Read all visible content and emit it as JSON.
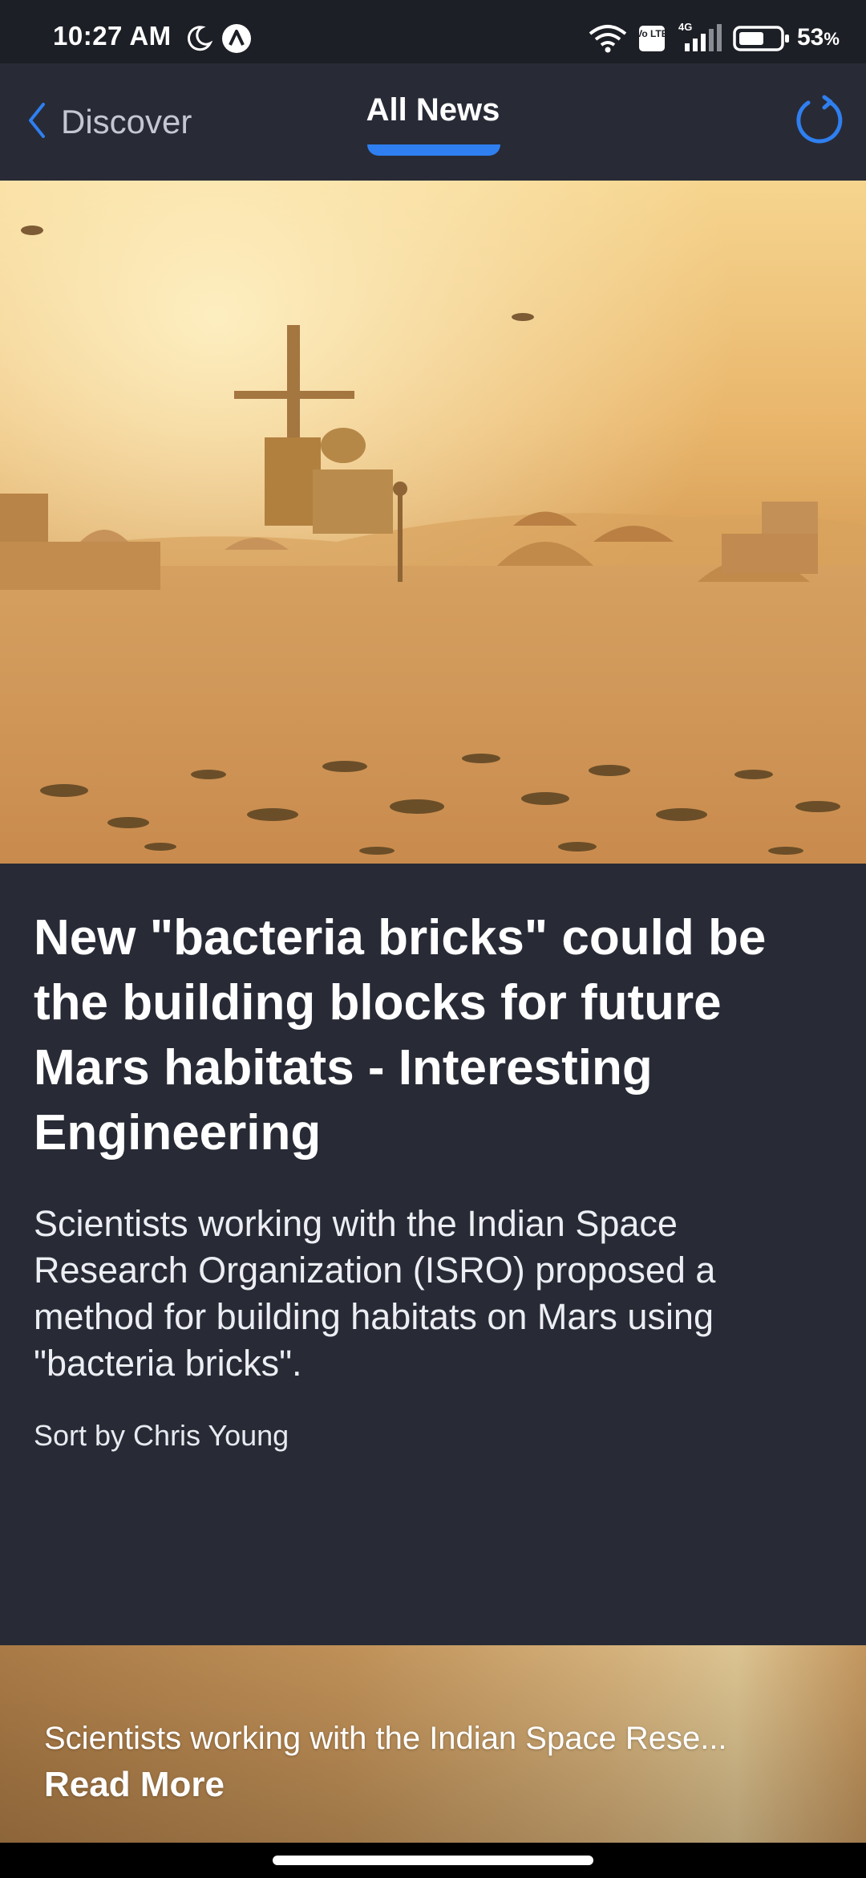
{
  "status_bar": {
    "time": "10:27 AM",
    "battery_level": "53",
    "battery_unit": "%",
    "network": "4G",
    "volte": "Vo LTE",
    "icons": [
      "moon-icon",
      "app-notification-icon",
      "wifi-icon",
      "volte-icon",
      "signal-icon",
      "battery-icon"
    ]
  },
  "nav": {
    "back_label": "Discover",
    "title": "All News",
    "accent_color": "#2f7ff0",
    "icons": [
      "chevron-left-icon",
      "refresh-icon"
    ]
  },
  "article": {
    "headline": "New \"bacteria bricks\" could be the building blocks for future Mars habitats - Interesting Engineering",
    "summary": "Scientists working with the Indian Space Research Organization (ISRO) proposed a method for building habitats on Mars using \"bacteria bricks\".",
    "byline": "Sort by Chris Young"
  },
  "next_card": {
    "snippet": "Scientists working with the Indian Space Rese...",
    "read_more": "Read More"
  },
  "colors": {
    "background": "#282b36",
    "status_bar": "#1d1f26",
    "text": "#ffffff"
  }
}
